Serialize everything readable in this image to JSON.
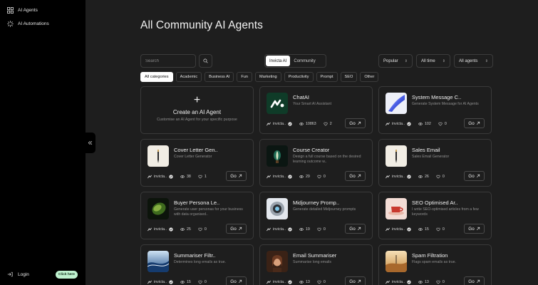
{
  "sidebar": {
    "items": [
      {
        "label": "AI Agents",
        "icon": "grid-icon"
      },
      {
        "label": "AI Automations",
        "icon": "sparkle-icon"
      }
    ],
    "login_label": "Login",
    "cta_label": "Click here"
  },
  "main": {
    "title": "All Community AI Agents",
    "search_placeholder": "Search",
    "segments": [
      "Invicta AI",
      "Community"
    ],
    "active_segment": "Invicta AI",
    "dropdowns": {
      "sort": "Popular",
      "time": "All time",
      "scope": "All agents"
    },
    "categories": [
      "All categories",
      "Academic",
      "Business AI",
      "Fun",
      "Marketing",
      "Productivity",
      "Prompt",
      "SEO",
      "Other"
    ],
    "active_category": "All categories",
    "create_card": {
      "title": "Create an AI Agent",
      "subtitle": "Customise an AI Agent for your specific purpose"
    },
    "go_label": "Go"
  },
  "agents": [
    {
      "name": "ChatAI",
      "desc": "Your Smart AI Assistant",
      "author": "invicta..",
      "views": "10863",
      "likes": "2",
      "thumb": "chat"
    },
    {
      "name": "System Message C..",
      "desc": "Generate System Message for AI Agents",
      "author": "invicta..",
      "views": "102",
      "likes": "0",
      "thumb": "system"
    },
    {
      "name": "Cover Letter Gen..",
      "desc": "Cover Letter Generator",
      "author": "invicta..",
      "views": "38",
      "likes": "1",
      "thumb": "pen"
    },
    {
      "name": "Course Creator",
      "desc": "Design a full course based on the desired learning outcome w..",
      "author": "invicta..",
      "views": "29",
      "likes": "0",
      "thumb": "course"
    },
    {
      "name": "Sales Email",
      "desc": "Sales Email Generator",
      "author": "invicta..",
      "views": "26",
      "likes": "0",
      "thumb": "pen"
    },
    {
      "name": "Buyer Persona Le..",
      "desc": "Generate user personas for your business with data organised..",
      "author": "invicta..",
      "views": "25",
      "likes": "0",
      "thumb": "persona"
    },
    {
      "name": "Midjourney Promp..",
      "desc": "Generate detailed Midjourney prompts",
      "author": "invicta..",
      "views": "19",
      "likes": "0",
      "thumb": "robot"
    },
    {
      "name": "SEO Optimised Ar..",
      "desc": "I write SEO-optimised articles from a few keywords",
      "author": "invicta..",
      "views": "15",
      "likes": "0",
      "thumb": "cup"
    },
    {
      "name": "Summariser Filtr..",
      "desc": "Determines long emails as true.",
      "author": "invicta..",
      "views": "15",
      "likes": "0",
      "thumb": "wave"
    },
    {
      "name": "Email Summariser",
      "desc": "Summarise long emails",
      "author": "invicta..",
      "views": "13",
      "likes": "0",
      "thumb": "portrait"
    },
    {
      "name": "Spam Filtration",
      "desc": "Flags spam emails as true.",
      "author": "invicta..",
      "views": "13",
      "likes": "0",
      "thumb": "desert"
    }
  ]
}
